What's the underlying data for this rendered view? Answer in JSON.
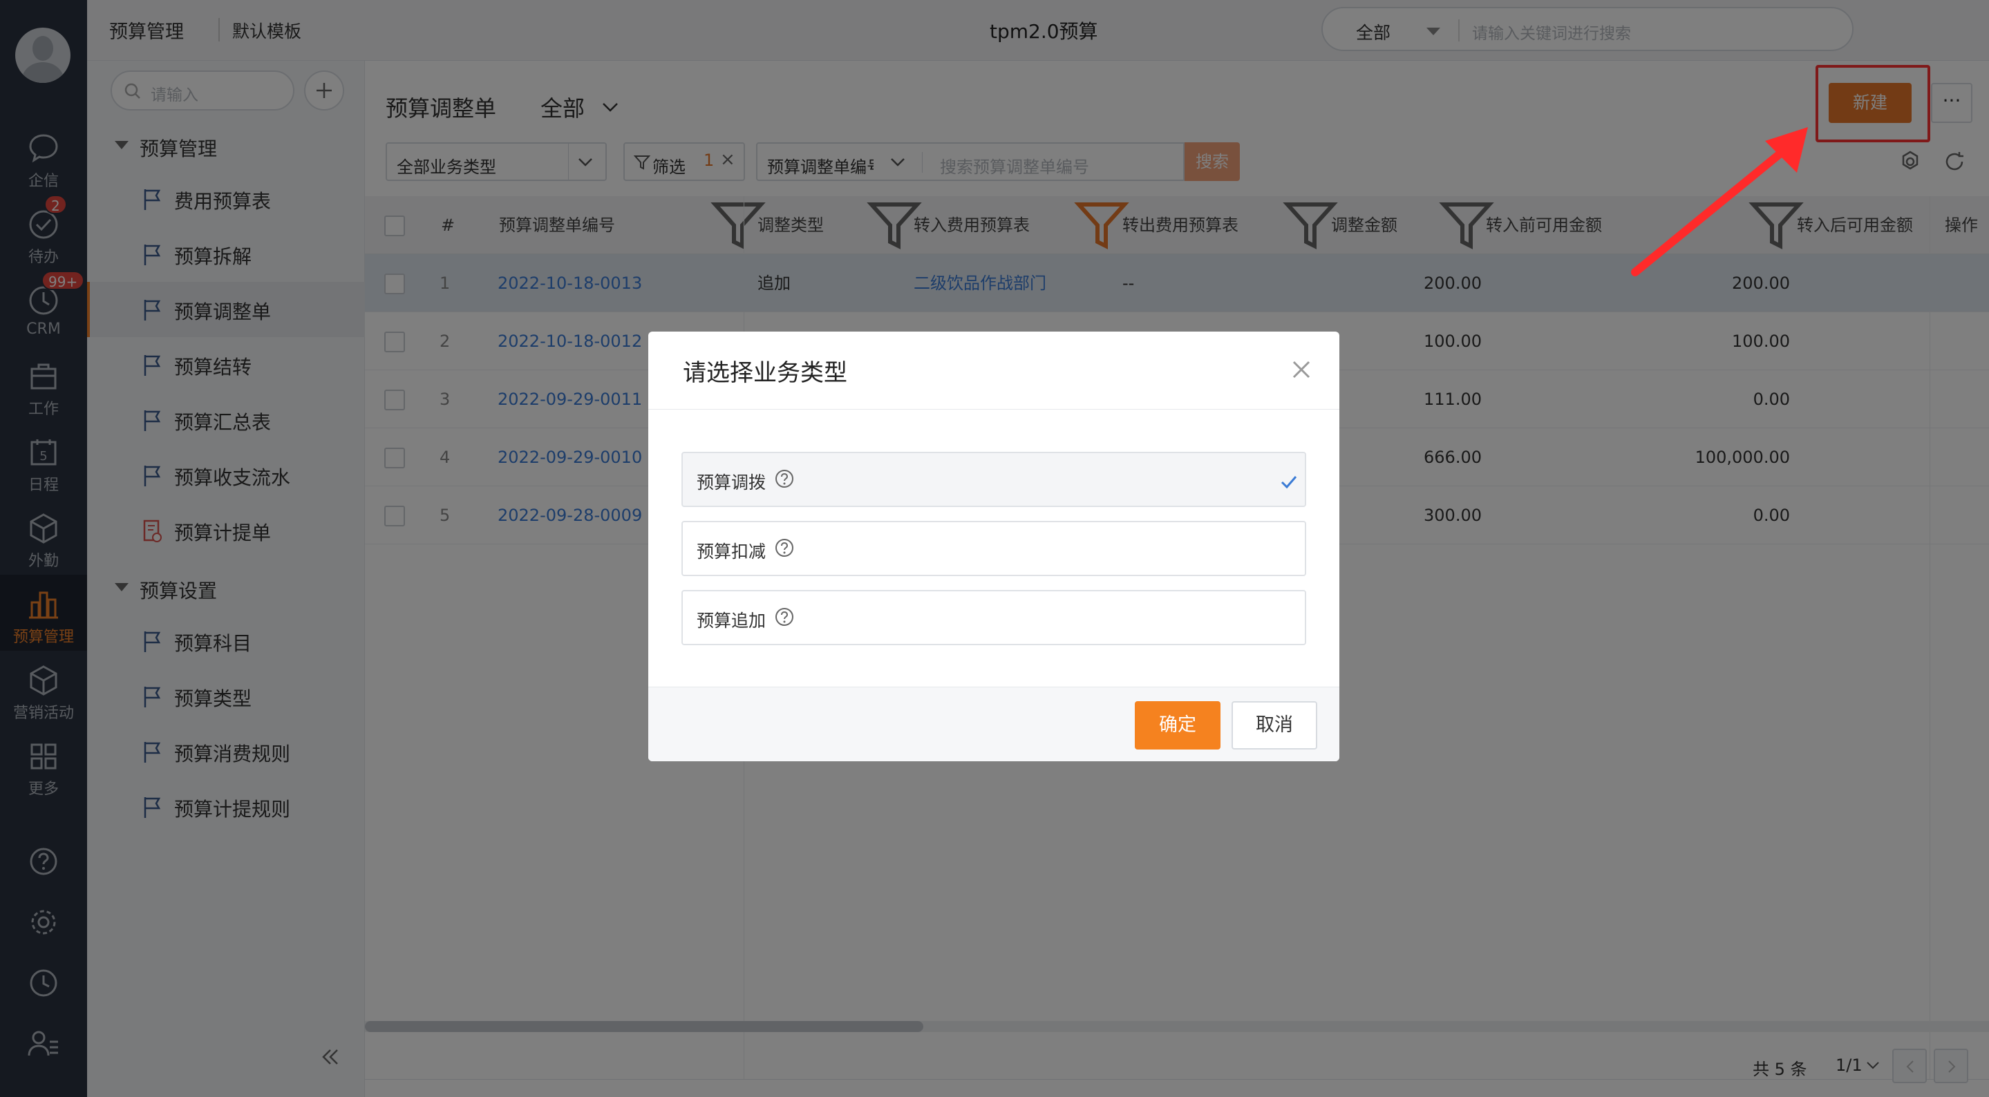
{
  "nav": {
    "items": [
      {
        "label": "企信",
        "icon": "chat-bubble-icon"
      },
      {
        "label": "待办",
        "icon": "check-circle-icon",
        "badge": "2"
      },
      {
        "label": "CRM",
        "icon": "clock-icon",
        "badge": "99+"
      },
      {
        "label": "工作",
        "icon": "briefcase-icon"
      },
      {
        "label": "日程",
        "icon": "calendar-icon",
        "day": "5"
      },
      {
        "label": "外勤",
        "icon": "cube-icon"
      },
      {
        "label": "预算管理",
        "icon": "bar-chart-icon",
        "active": true
      },
      {
        "label": "营销活动",
        "icon": "box-icon"
      },
      {
        "label": "更多",
        "icon": "grid-icon"
      }
    ],
    "bottom_icons": [
      "help-icon",
      "settings-icon",
      "history-icon",
      "user-list-icon"
    ],
    "accent": "#f5822a"
  },
  "topbar": {
    "section": "预算管理",
    "template": "默认模板",
    "center_title": "tpm2.0预算",
    "search": {
      "scope": "全部",
      "placeholder": "请输入关键词进行搜索"
    }
  },
  "sidebar": {
    "search_placeholder": "请输入",
    "groups": [
      {
        "label": "预算管理",
        "items": [
          "费用预算表",
          "预算拆解",
          "预算调整单",
          "预算结转",
          "预算汇总表",
          "预算收支流水",
          "预算计提单"
        ]
      },
      {
        "label": "预算设置",
        "items": [
          "预算科目",
          "预算类型",
          "预算消费规则",
          "预算计提规则"
        ]
      }
    ],
    "active_item": "预算调整单"
  },
  "page": {
    "title": "预算调整单",
    "scope": "全部",
    "new_button": "新建",
    "more_button": "···",
    "filters": {
      "business_type": "全部业务类型",
      "filter_label": "筛选",
      "filter_count": "1",
      "search_field": "预算调整单编号",
      "search_placeholder": "搜索预算调整单编号",
      "search_button": "搜索"
    }
  },
  "table": {
    "columns": [
      "#",
      "预算调整单编号",
      "调整类型",
      "转入费用预算表",
      "转出费用预算表",
      "调整金额",
      "转入前可用金额",
      "转入后可用金额",
      "操作"
    ],
    "rows": [
      {
        "no": "1",
        "code": "2022-10-18-0013",
        "type": "追加",
        "in_table": "二级饮品作战部门",
        "out_table": "--",
        "amount": "200.00",
        "before": "200.00"
      },
      {
        "no": "2",
        "code": "2022-10-18-0012",
        "type": "",
        "in_table": "",
        "out_table": "",
        "amount": "100.00",
        "before": "100.00"
      },
      {
        "no": "3",
        "code": "2022-09-29-0011",
        "type": "",
        "in_table": "",
        "out_table": "",
        "amount": "111.00",
        "before": "0.00"
      },
      {
        "no": "4",
        "code": "2022-09-29-0010",
        "type": "",
        "in_table": "",
        "out_table": "",
        "amount": "666.00",
        "before": "100,000.00"
      },
      {
        "no": "5",
        "code": "2022-09-28-0009",
        "type": "",
        "in_table": "",
        "out_table": "",
        "amount": "300.00",
        "before": "0.00"
      }
    ]
  },
  "pagination": {
    "total": "共 5 条",
    "page": "1/1"
  },
  "modal": {
    "title": "请选择业务类型",
    "options": [
      {
        "label": "预算调拨",
        "selected": true
      },
      {
        "label": "预算扣减",
        "selected": false
      },
      {
        "label": "预算追加",
        "selected": false
      }
    ],
    "ok": "确定",
    "cancel": "取消",
    "ok_color": "#f5821f",
    "check_color": "#3a7bd5"
  },
  "annotation": {
    "highlight_color": "#ff3333"
  }
}
